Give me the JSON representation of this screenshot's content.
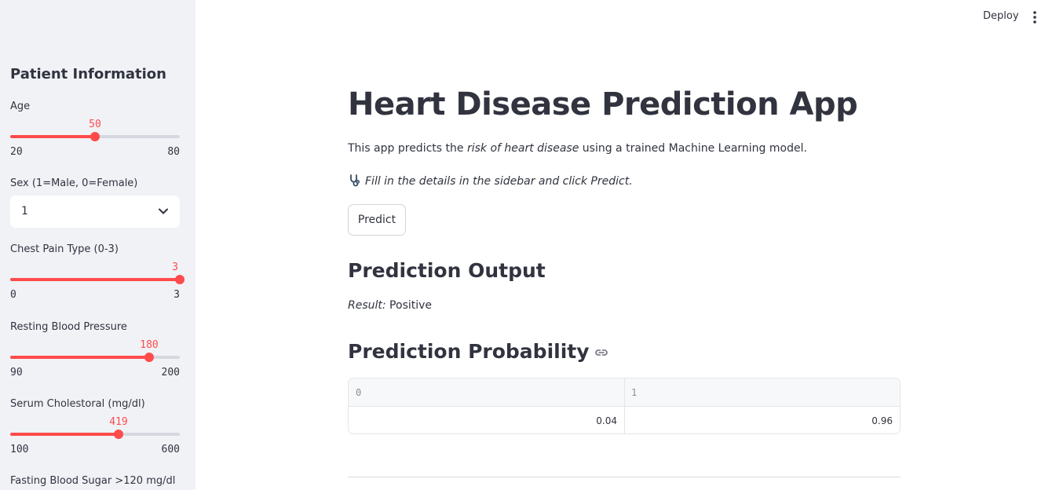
{
  "topbar": {
    "deploy_label": "Deploy",
    "menu_icon": "vertical-ellipsis-icon"
  },
  "sidebar": {
    "title": "Patient Information",
    "age": {
      "label": "Age",
      "value": 50,
      "min": 20,
      "max": 80
    },
    "sex": {
      "label": "Sex (1=Male, 0=Female)",
      "selected": "1"
    },
    "chest_pain": {
      "label": "Chest Pain Type (0-3)",
      "value": 3,
      "min": 0,
      "max": 3
    },
    "bp": {
      "label": "Resting Blood Pressure",
      "value": 180,
      "min": 90,
      "max": 200
    },
    "chol": {
      "label": "Serum Cholestoral (mg/dl)",
      "value": 419,
      "min": 100,
      "max": 600
    },
    "fbs": {
      "label": "Fasting Blood Sugar >120 mg/dl"
    }
  },
  "main": {
    "title": "Heart Disease Prediction App",
    "intro_before": "This app predicts the ",
    "intro_em": "risk of heart disease",
    "intro_after": " using a trained Machine Learning model.",
    "hint": "Fill in the details in the sidebar and click Predict.",
    "predict_label": "Predict",
    "output_heading": "Prediction Output",
    "result_label": "Result:",
    "result_value": " Positive",
    "prob_heading": "Prediction Probability",
    "table": {
      "headers": [
        "0",
        "1"
      ],
      "row": [
        "0.04",
        "0.96"
      ]
    }
  },
  "colors": {
    "accent": "#ff4b4b",
    "sidebar_bg": "#f0f2f6",
    "text": "#31333f"
  }
}
